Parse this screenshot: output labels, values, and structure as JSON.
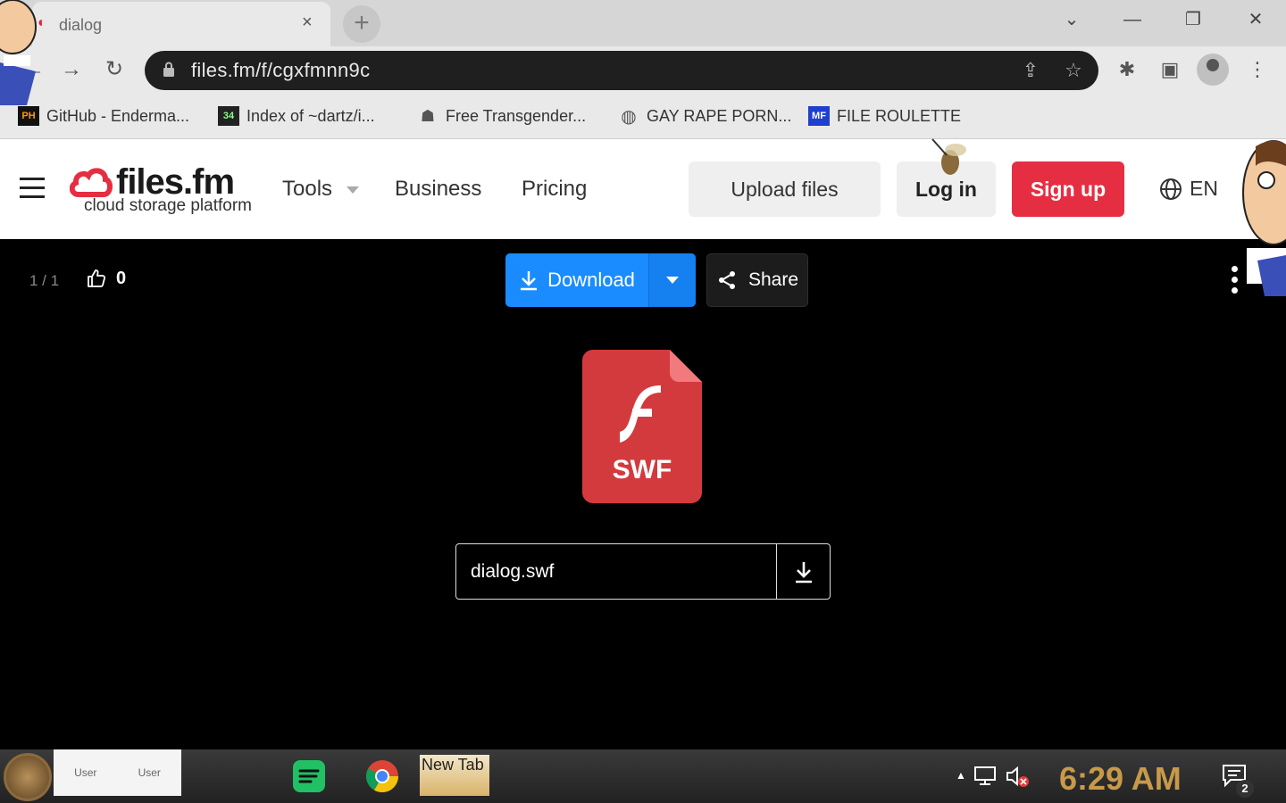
{
  "browser": {
    "tab": {
      "title": "dialog",
      "close": "×"
    },
    "new_tab": "+",
    "window_controls": {
      "tab_search": "⌄",
      "minimize": "—",
      "restore": "❐",
      "close": "✕"
    },
    "url": "files.fm/f/cgxfmnn9c",
    "bookmarks": [
      {
        "icon": "PH",
        "label": "GitHub - Enderma..."
      },
      {
        "icon": "34",
        "label": "Index of ~dartz/i..."
      },
      {
        "icon": "",
        "label": "Free Transgender..."
      },
      {
        "icon": "",
        "label": "GAY RAPE PORN..."
      },
      {
        "icon": "MF",
        "label": "FILE ROULETTE"
      }
    ]
  },
  "site": {
    "logo": {
      "name": "files.fm",
      "tagline": "cloud storage platform"
    },
    "nav": {
      "tools": "Tools",
      "business": "Business",
      "pricing": "Pricing"
    },
    "buttons": {
      "upload": "Upload files",
      "login": "Log in",
      "signup": "Sign up"
    },
    "language": "EN"
  },
  "viewer": {
    "counter": "1 / 1",
    "likes": "0",
    "download_label": "Download",
    "share_label": "Share",
    "file_type": "SWF",
    "filename": "dialog.swf"
  },
  "taskbar": {
    "user_labels": [
      "User",
      "User"
    ],
    "new_tab_thumb": "New Tab",
    "clock": "6:29 AM",
    "notifications": "2"
  },
  "colors": {
    "download_blue": "#1a8cff",
    "signup_red": "#e62e42",
    "swf_red": "#d33a3e",
    "clock_gold": "#c79a4a"
  }
}
